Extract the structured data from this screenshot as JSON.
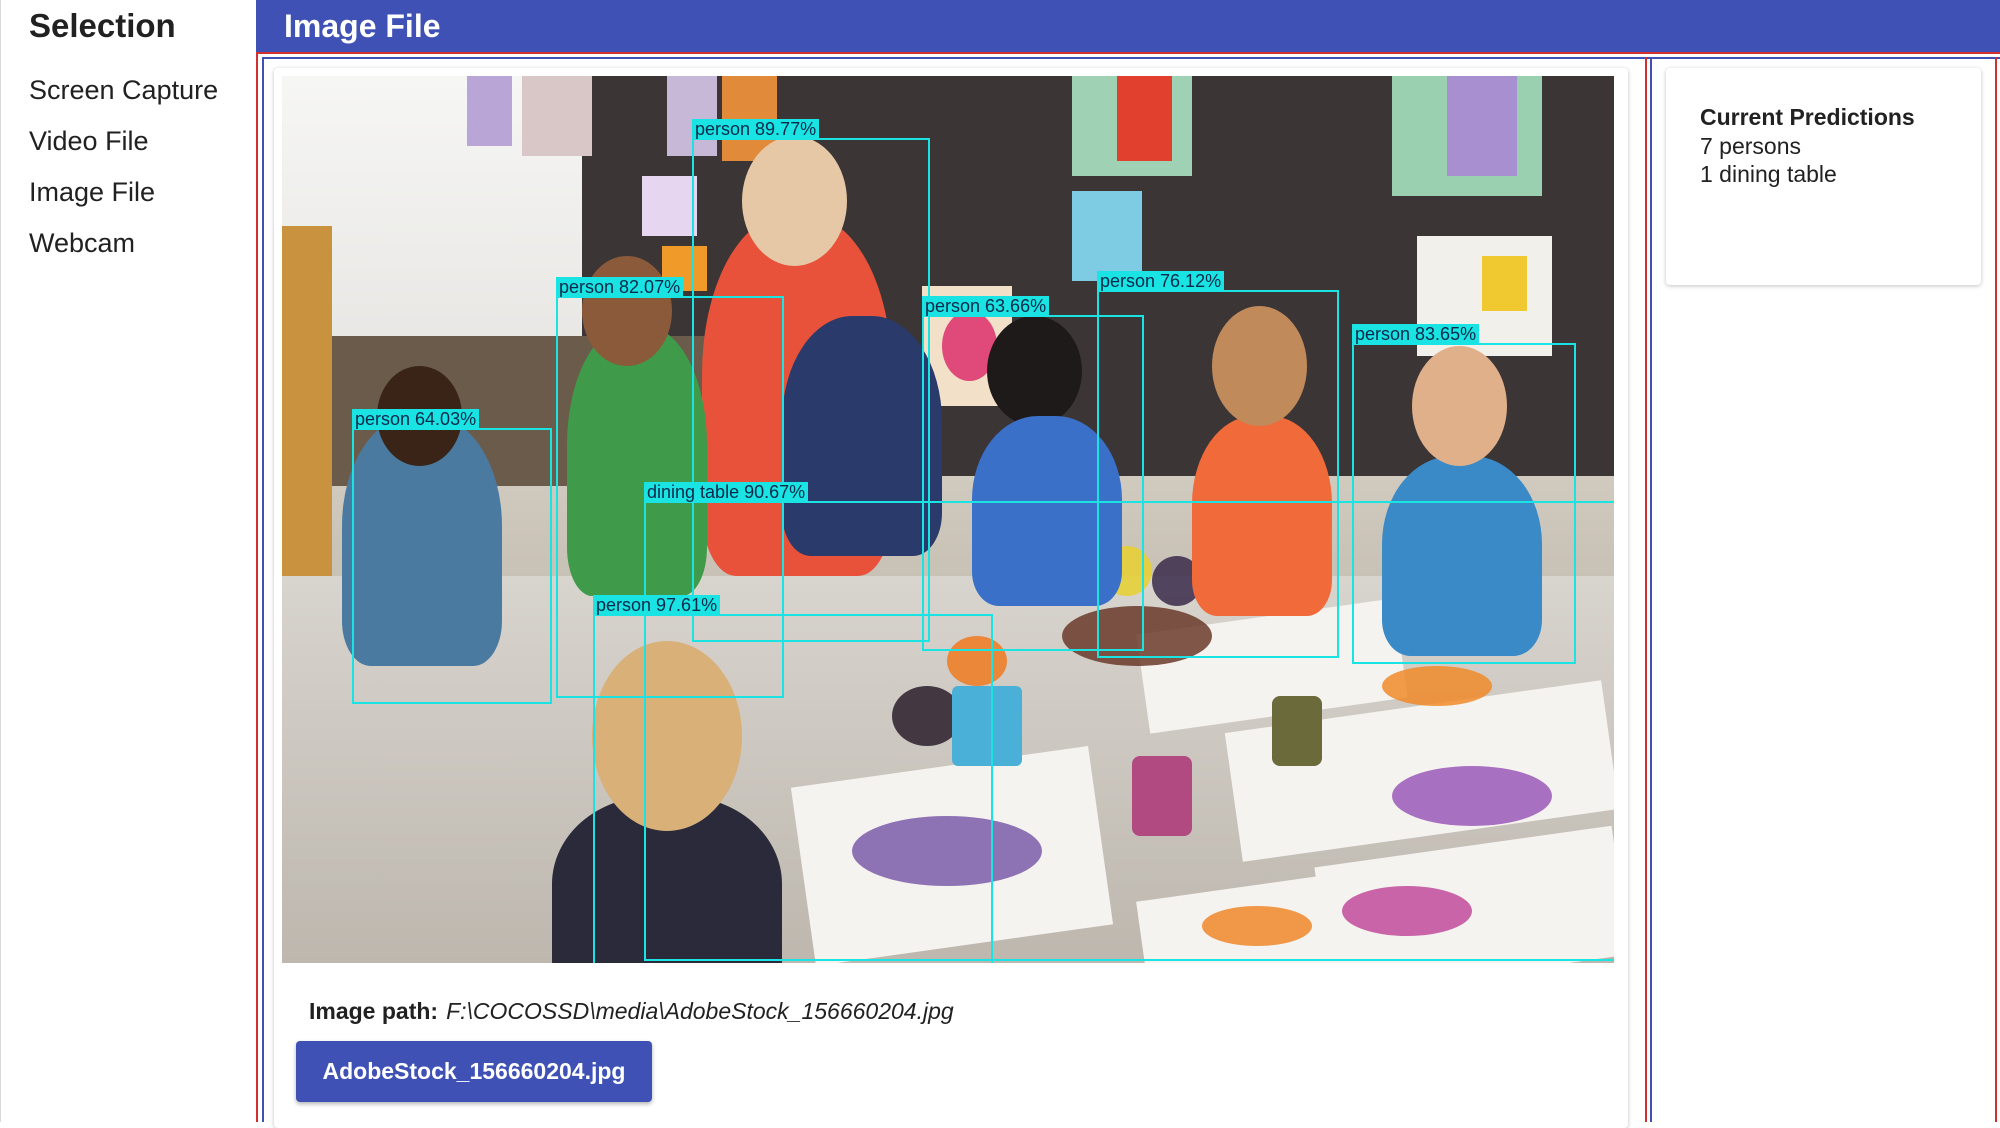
{
  "sidebar": {
    "title": "Selection",
    "items": [
      {
        "label": "Screen Capture"
      },
      {
        "label": "Video File"
      },
      {
        "label": "Image File"
      },
      {
        "label": "Webcam"
      }
    ]
  },
  "header": {
    "title": "Image File"
  },
  "image": {
    "detections": [
      {
        "label": "person 89.77%"
      },
      {
        "label": "person 82.07%"
      },
      {
        "label": "person 63.66%"
      },
      {
        "label": "person 76.12%"
      },
      {
        "label": "person 83.65%"
      },
      {
        "label": "person 64.03%"
      },
      {
        "label": "dining table 90.67%"
      },
      {
        "label": "person 97.61%"
      }
    ],
    "box_color": "#19e3e3"
  },
  "path": {
    "label": "Image path:",
    "value": "F:\\COCOSSD\\media\\AdobeStock_156660204.jpg"
  },
  "file_button": {
    "label": "AdobeStock_156660204.jpg"
  },
  "predictions": {
    "title": "Current Predictions",
    "lines": [
      "7 persons",
      "1 dining table"
    ]
  },
  "colors": {
    "primary": "#3f51b5",
    "accent_red": "#d32f2f"
  }
}
